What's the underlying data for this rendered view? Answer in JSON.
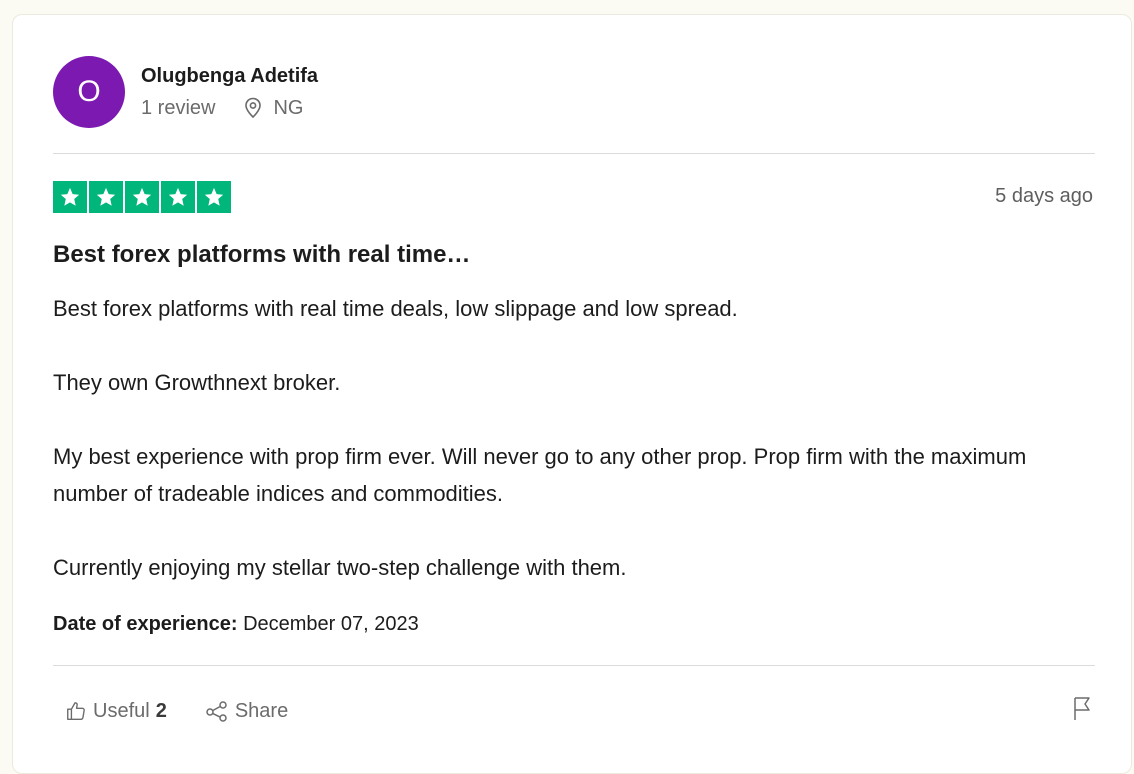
{
  "reviewer": {
    "avatar_letter": "O",
    "avatar_color": "#7c19b0",
    "name": "Olugbenga Adetifa",
    "reviews": "1 review",
    "location": "NG"
  },
  "rating": {
    "stars": 5,
    "max": 5,
    "color": "#00b67a"
  },
  "posted": "5 days ago",
  "review": {
    "title": "Best forex platforms with real time…",
    "paragraphs": [
      "Best forex platforms with real time deals, low slippage and low spread.",
      "They own Growthnext broker.",
      "My best experience with prop firm ever. Will never go to any other prop. Prop firm with the maximum number of tradeable indices and commodities.",
      "Currently enjoying my stellar two-step challenge with them."
    ]
  },
  "experience": {
    "label": "Date of experience:",
    "date": "December 07, 2023"
  },
  "actions": {
    "useful_label": "Useful",
    "useful_count": "2",
    "share_label": "Share"
  },
  "icons": {
    "location": "location-pin-icon",
    "useful": "thumbs-up-icon",
    "share": "share-icon",
    "report": "flag-icon",
    "star": "star-icon"
  }
}
